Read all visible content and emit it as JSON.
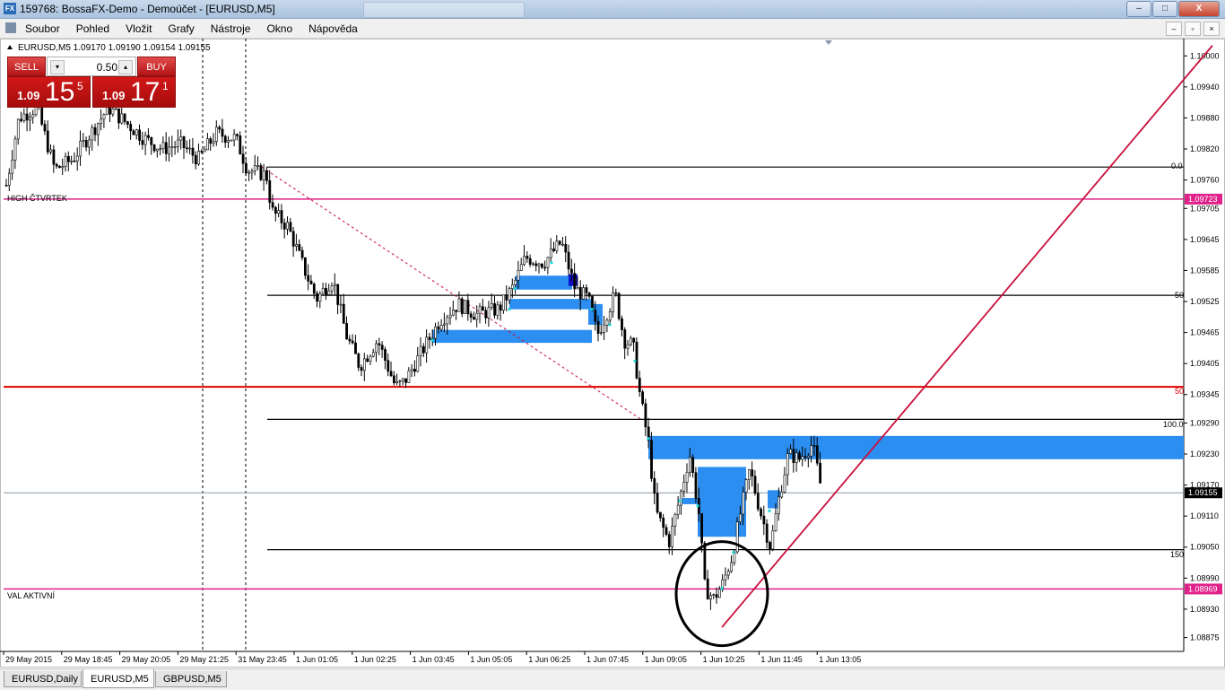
{
  "window": {
    "title": "159768: BossaFX-Demo - Demoúčet - [EURUSD,M5]",
    "icon_label": "FX",
    "minimize": "–",
    "maximize": "□",
    "close": "X"
  },
  "menu": [
    "Soubor",
    "Pohled",
    "Vložit",
    "Grafy",
    "Nástroje",
    "Okno",
    "Nápověda"
  ],
  "mdi": {
    "minimize": "–",
    "restore": "▫",
    "close": "×"
  },
  "symbol_info": "EURUSD,M5  1.09170 1.09190 1.09154 1.09155",
  "trade_panel": {
    "sell_label": "SELL",
    "buy_label": "BUY",
    "lot": "0.50",
    "dec": "▾",
    "inc": "▴",
    "sell_price_small": "1.09",
    "sell_price_big": "15",
    "sell_price_sup": "5",
    "buy_price_small": "1.09",
    "buy_price_big": "17",
    "buy_price_sup": "1"
  },
  "chart_labels": {
    "high_quarter": "HIGH ČTVRTEK",
    "val_active": "VAL AKTIVNÍ",
    "fib_0": "0.0",
    "fib_50": "50",
    "fib_50_red": "50",
    "fib_100": "100.0",
    "fib_150": "150"
  },
  "chart_data": {
    "type": "candlestick",
    "symbol": "EURUSD",
    "timeframe": "M5",
    "ylim": [
      1.0885,
      1.1003
    ],
    "y_ticks": [
      "1.10000",
      "1.09940",
      "1.09880",
      "1.09820",
      "1.09760",
      "1.09705",
      "1.09645",
      "1.09585",
      "1.09525",
      "1.09465",
      "1.09405",
      "1.09345",
      "1.09290",
      "1.09230",
      "1.09170",
      "1.09110",
      "1.09050",
      "1.08990",
      "1.08930",
      "1.08875"
    ],
    "x_ticks": [
      "29 May 2015",
      "29 May 18:45",
      "29 May 20:05",
      "29 May 21:25",
      "31 May 23:45",
      "1 Jun 01:05",
      "1 Jun 02:25",
      "1 Jun 03:45",
      "1 Jun 05:05",
      "1 Jun 06:25",
      "1 Jun 07:45",
      "1 Jun 09:05",
      "1 Jun 10:25",
      "1 Jun 11:45",
      "1 Jun 13:05"
    ],
    "price_badges": [
      {
        "price": 1.09723,
        "label": "1.09723",
        "color": "#e0218a"
      },
      {
        "price": 1.09155,
        "label": "1.09155",
        "color": "#000000"
      },
      {
        "price": 1.08969,
        "label": "1.08969",
        "color": "#e0218a"
      }
    ],
    "current_price": 1.09155,
    "horizontal_levels": [
      {
        "price": 1.09785,
        "color": "#000000",
        "label": "0.0"
      },
      {
        "price": 1.09723,
        "color": "#e0218a",
        "label": "HIGH ČTVRTEK"
      },
      {
        "price": 1.09537,
        "color": "#000000",
        "label": "50"
      },
      {
        "price": 1.0936,
        "color": "#e00000",
        "label": "50"
      },
      {
        "price": 1.09297,
        "color": "#000000",
        "label": "100.0"
      },
      {
        "price": 1.09045,
        "color": "#000000",
        "label": "150"
      },
      {
        "price": 1.08969,
        "color": "#e0218a",
        "label": "VAL AKTIVNÍ"
      }
    ],
    "trendline_color": "#c8103c",
    "zone_color": "#2c8ef0",
    "candle_up_color": "#ffffff",
    "candle_down_color": "#000000",
    "grid": false
  },
  "tabs": [
    {
      "label": "EURUSD,Daily",
      "active": false
    },
    {
      "label": "EURUSD,M5",
      "active": true
    },
    {
      "label": "GBPUSD,M5",
      "active": false
    }
  ]
}
